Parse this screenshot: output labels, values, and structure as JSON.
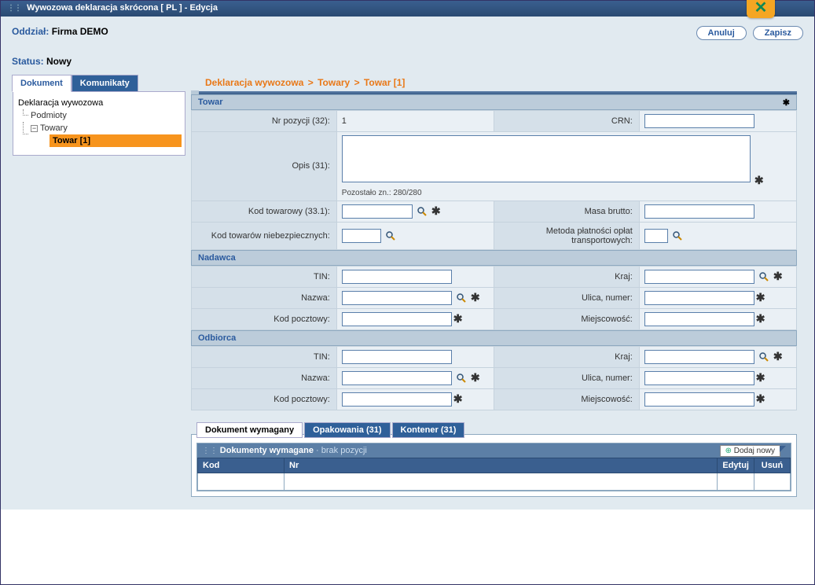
{
  "titlebar": "Wywozowa deklaracja skrócona [ PL ]   -   Edycja",
  "close_symbol": "✕",
  "header": {
    "branch_label": "Oddział:",
    "branch_value": "Firma DEMO",
    "status_label": "Status:",
    "status_value": "Nowy",
    "btn_cancel": "Anuluj",
    "btn_save": "Zapisz"
  },
  "tabs_left": [
    "Dokument",
    "Komunikaty"
  ],
  "tree": {
    "root": "Deklaracja wywozowa",
    "child1": "Podmioty",
    "child2": "Towary",
    "leaf": "Towar [1]"
  },
  "breadcrumb": [
    "Deklaracja wywozowa",
    "Towary",
    "Towar [1]"
  ],
  "sections": {
    "towar": "Towar",
    "nadawca": "Nadawca",
    "odbiorca": "Odbiorca"
  },
  "fields": {
    "nr_pozycji_lab": "Nr pozycji (32):",
    "nr_pozycji_val": "1",
    "crn_lab": "CRN:",
    "opis_lab": "Opis (31):",
    "pozostalo": "Pozostało zn.: 280/280",
    "kod_towarowy_lab": "Kod towarowy (33.1):",
    "masa_brutto_lab": "Masa brutto:",
    "kod_towarow_niebezp_lab": "Kod towarów niebezpiecznych:",
    "metoda_platnosci_lab": "Metoda płatności opłat transportowych:",
    "tin_lab": "TIN:",
    "kraj_lab": "Kraj:",
    "nazwa_lab": "Nazwa:",
    "ulica_lab": "Ulica, numer:",
    "kod_pocztowy_lab": "Kod pocztowy:",
    "miejscowosc_lab": "Miejscowość:"
  },
  "subtabs": [
    "Dokument wymagany",
    "Opakowania (31)",
    "Kontener (31)"
  ],
  "docs_panel": {
    "title": "Dokumenty wymagane",
    "brak": "brak pozycji",
    "add_new": "Dodaj nowy"
  },
  "docs_headers": {
    "kod": "Kod",
    "nr": "Nr",
    "edytuj": "Edytuj",
    "usun": "Usuń"
  }
}
